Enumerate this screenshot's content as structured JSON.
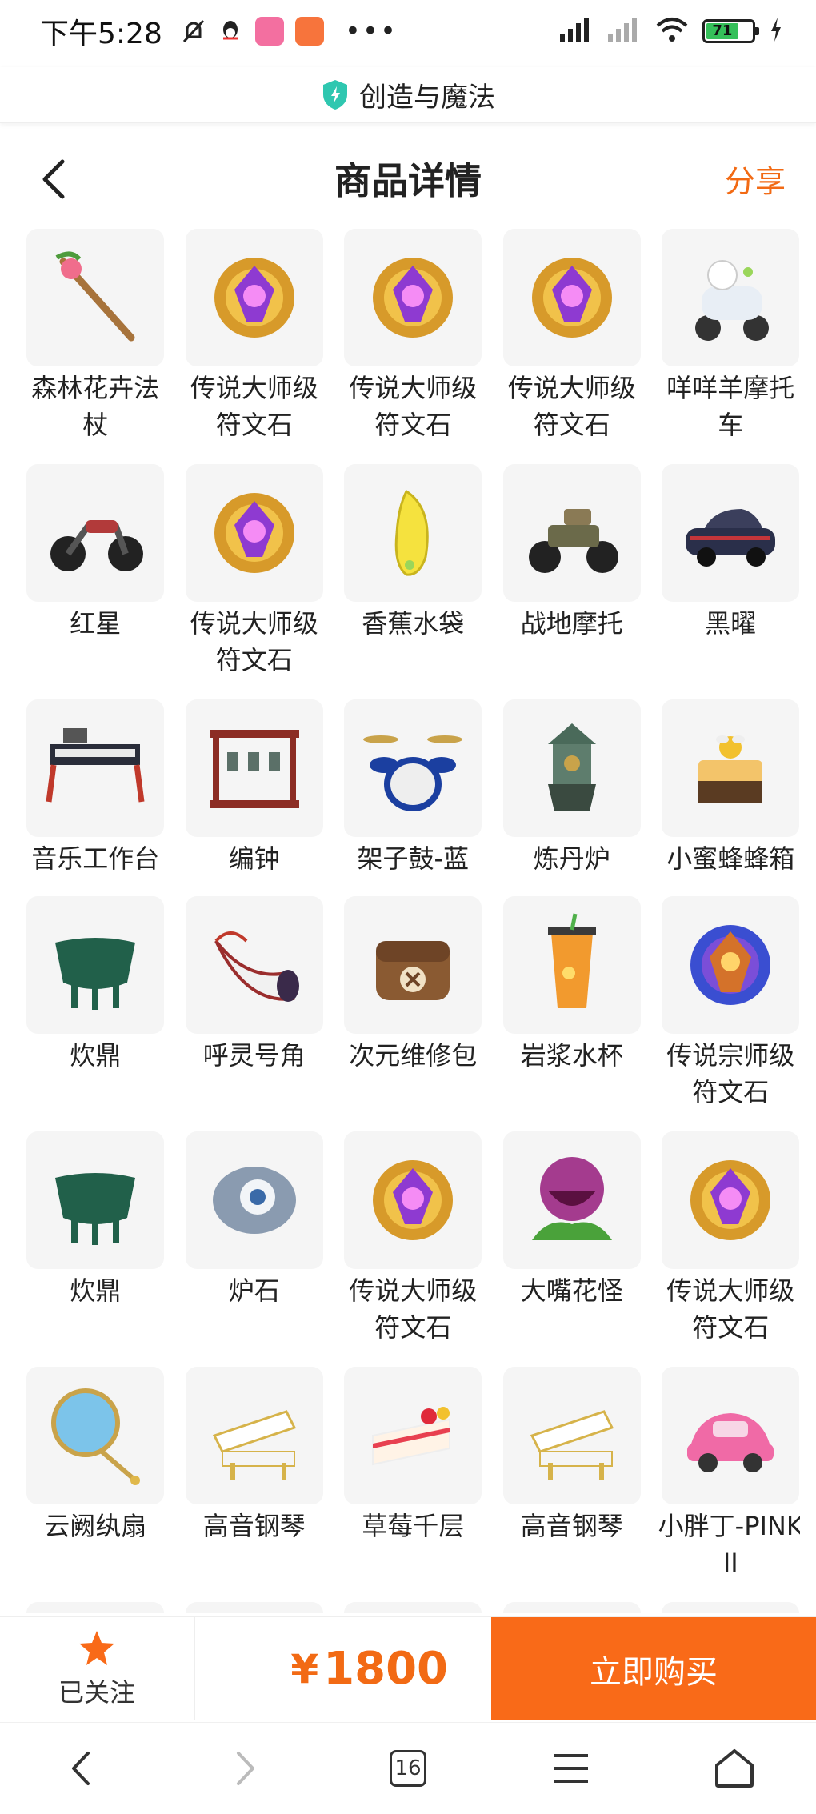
{
  "status_bar": {
    "time": "下午5:28",
    "battery": "71"
  },
  "site": {
    "title": "创造与魔法"
  },
  "nav": {
    "title": "商品详情",
    "share_label": "分享"
  },
  "items": [
    {
      "label": "森林花卉法杖",
      "icon": "flower-staff-icon"
    },
    {
      "label": "传说大师级符文石",
      "icon": "rune-stone-icon"
    },
    {
      "label": "传说大师级符文石",
      "icon": "rune-stone-icon"
    },
    {
      "label": "传说大师级符文石",
      "icon": "rune-stone-icon"
    },
    {
      "label": "咩咩羊摩托车",
      "icon": "sheep-scooter-icon"
    },
    {
      "label": "红星",
      "icon": "motorcycle-icon"
    },
    {
      "label": "传说大师级符文石",
      "icon": "rune-stone-icon"
    },
    {
      "label": "香蕉水袋",
      "icon": "banana-bag-icon"
    },
    {
      "label": "战地摩托",
      "icon": "war-motorcycle-icon"
    },
    {
      "label": "黑曜",
      "icon": "car-icon"
    },
    {
      "label": "音乐工作台",
      "icon": "music-workstation-icon"
    },
    {
      "label": "编钟",
      "icon": "chime-bells-icon"
    },
    {
      "label": "架子鼓-蓝",
      "icon": "drum-kit-icon"
    },
    {
      "label": "炼丹炉",
      "icon": "alchemy-furnace-icon"
    },
    {
      "label": "小蜜蜂蜂箱",
      "icon": "beehive-icon"
    },
    {
      "label": "炊鼎",
      "icon": "cauldron-icon"
    },
    {
      "label": "呼灵号角",
      "icon": "horn-icon"
    },
    {
      "label": "次元维修包",
      "icon": "repair-bag-icon"
    },
    {
      "label": "岩浆水杯",
      "icon": "lava-cup-icon"
    },
    {
      "label": "传说宗师级符文石",
      "icon": "grandmaster-rune-icon"
    },
    {
      "label": "炊鼎",
      "icon": "cauldron-icon"
    },
    {
      "label": "炉石",
      "icon": "hearthstone-icon"
    },
    {
      "label": "传说大师级符文石",
      "icon": "rune-stone-icon"
    },
    {
      "label": "大嘴花怪",
      "icon": "piranha-plant-icon"
    },
    {
      "label": "传说大师级符文石",
      "icon": "rune-stone-icon"
    },
    {
      "label": "云阙纨扇",
      "icon": "round-fan-icon"
    },
    {
      "label": "高音钢琴",
      "icon": "piano-icon"
    },
    {
      "label": "草莓千层",
      "icon": "cake-icon"
    },
    {
      "label": "高音钢琴",
      "icon": "piano-icon"
    },
    {
      "label": "小胖丁-PINK II",
      "icon": "pink-car-icon"
    }
  ],
  "action_bar": {
    "follow_label": "已关注",
    "price_symbol": "¥",
    "price_value": "1800",
    "buy_label": "立即购买"
  },
  "system_nav": {
    "tabs_count": "16"
  },
  "colors": {
    "accent": "#f96a18",
    "price": "#f26a14",
    "thumb_bg": "#f5f5f5"
  }
}
